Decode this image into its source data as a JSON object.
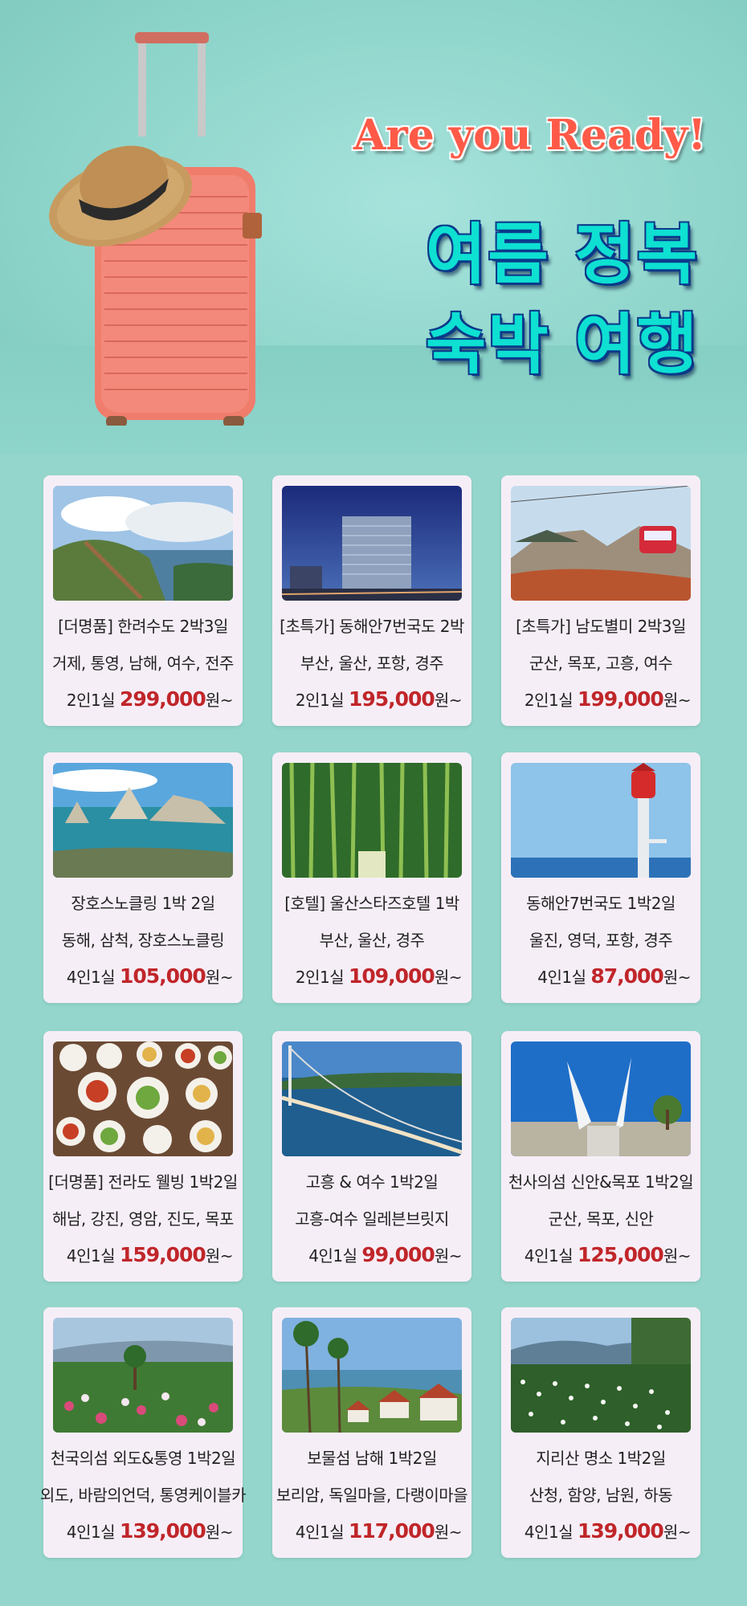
{
  "hero": {
    "tagline": "Are you Ready!",
    "title_line1": "여름 정복",
    "title_line2": "숙박 여행"
  },
  "colors": {
    "background": "#94d6cc",
    "card": "#f6eef7",
    "price": "#c0262a",
    "tagline": "#ff5a47",
    "title": "#0ee0d2",
    "title_outline": "#0b3a8a"
  },
  "products": [
    {
      "title": "[더명품] 한려수도 2박3일",
      "route": "거제, 통영, 남해, 여수, 전주",
      "room": "2인1실",
      "price": "299,000",
      "unit": "원~",
      "image": "coastal-boardwalk"
    },
    {
      "title": "[초특가] 동해안7번국도 2박",
      "route": "부산, 울산, 포항, 경주",
      "room": "2인1실",
      "price": "195,000",
      "unit": "원~",
      "image": "hotel-night"
    },
    {
      "title": "[초특가] 남도별미 2박3일",
      "route": "군산, 목포, 고흥, 여수",
      "room": "2인1실",
      "price": "199,000",
      "unit": "원~",
      "image": "cable-car"
    },
    {
      "title": "장호스노클링 1박 2일",
      "route": "동해, 삼척, 장호스노클링",
      "room": "4인1실",
      "price": "105,000",
      "unit": "원~",
      "image": "sea-rocks"
    },
    {
      "title": "[호텔] 울산스타즈호텔 1박",
      "route": "부산, 울산, 경주",
      "room": "2인1실",
      "price": "109,000",
      "unit": "원~",
      "image": "bamboo-forest"
    },
    {
      "title": "동해안7번국도 1박2일",
      "route": "울진, 영덕, 포항, 경주",
      "room": "4인1실",
      "price": "87,000",
      "unit": "원~",
      "image": "lighthouse"
    },
    {
      "title": "[더명품] 전라도 웰빙 1박2일",
      "route": "해남, 강진, 영암, 진도, 목포",
      "room": "4인1실",
      "price": "159,000",
      "unit": "원~",
      "image": "korean-table"
    },
    {
      "title": "고흥 & 여수 1박2일",
      "route": "고흥-여수 일레븐브릿지",
      "room": "4인1실",
      "price": "99,000",
      "unit": "원~",
      "image": "suspension-bridge"
    },
    {
      "title": "천사의섬 신안&목포 1박2일",
      "route": "군산, 목포, 신안",
      "room": "4인1실",
      "price": "125,000",
      "unit": "원~",
      "image": "white-monument"
    },
    {
      "title": "천국의섬 외도&통영 1박2일",
      "route": "외도, 바람의언덕, 통영케이블카",
      "room": "4인1실",
      "price": "139,000",
      "unit": "원~",
      "image": "flower-garden"
    },
    {
      "title": "보물섬 남해 1박2일",
      "route": "보리암, 독일마을, 다랭이마을",
      "room": "4인1실",
      "price": "117,000",
      "unit": "원~",
      "image": "village-pines"
    },
    {
      "title": "지리산 명소 1박2일",
      "route": "산청, 함양, 남원, 하동",
      "room": "4인1실",
      "price": "139,000",
      "unit": "원~",
      "image": "calla-field"
    }
  ]
}
